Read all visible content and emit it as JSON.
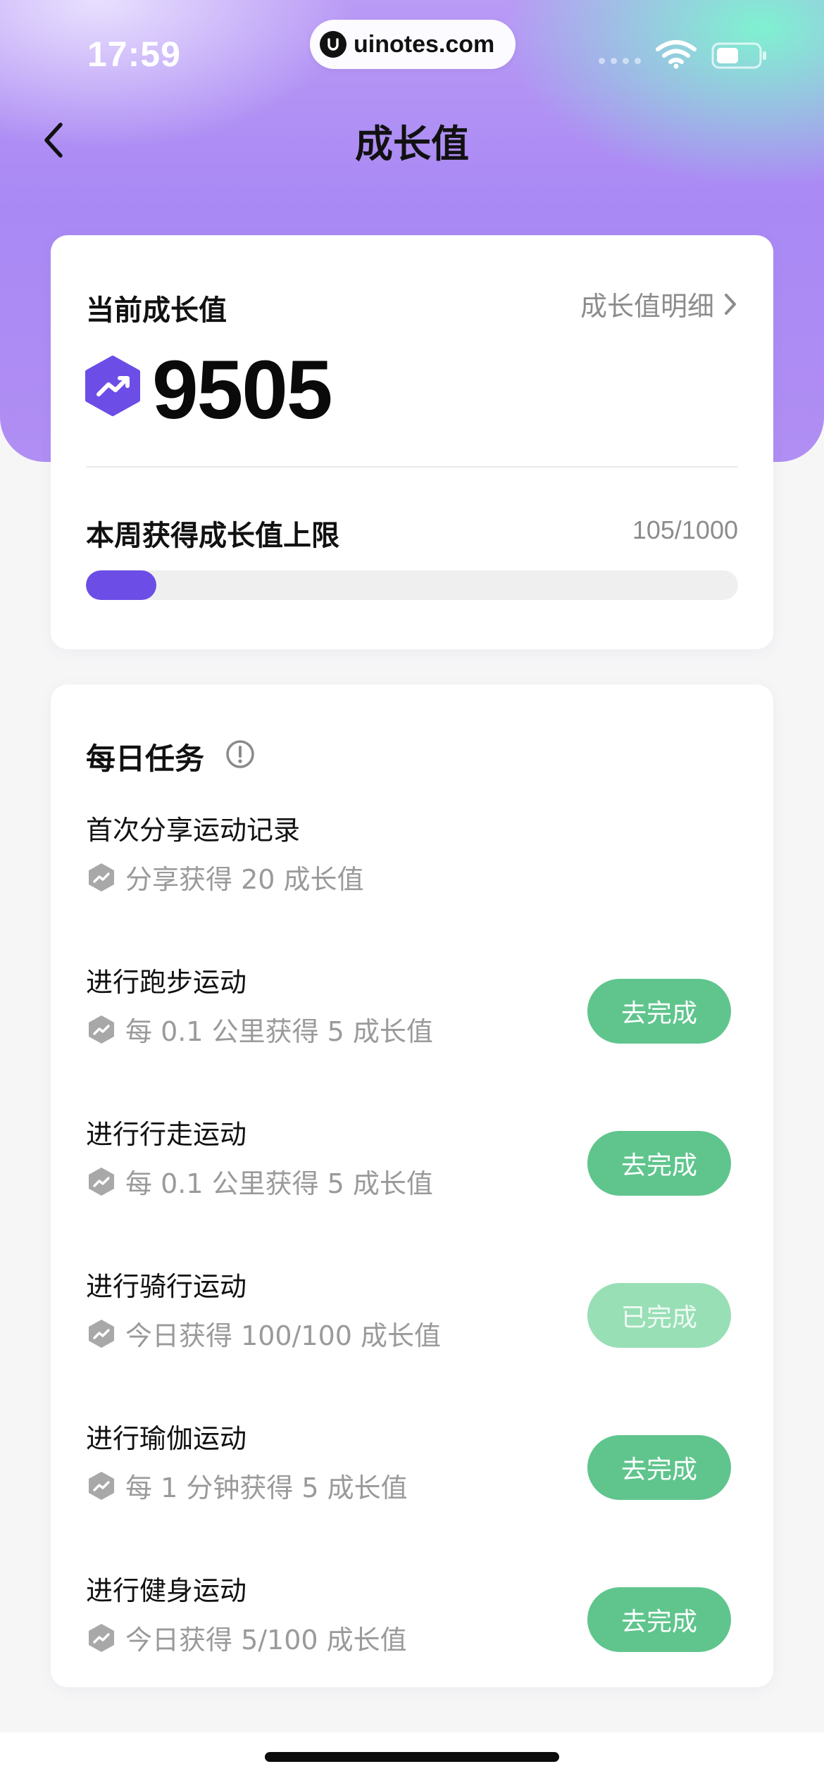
{
  "status_bar": {
    "time": "17:59",
    "url": "uinotes.com"
  },
  "nav": {
    "title": "成长值"
  },
  "summary": {
    "current_label": "当前成长值",
    "detail_link": "成长值明细",
    "value": "9505",
    "weekly_limit_label": "本周获得成长值上限",
    "weekly_count": "105/1000",
    "weekly_progress_fraction": 0.105
  },
  "tasks": {
    "title": "每日任务",
    "items": [
      {
        "name": "首次分享运动记录",
        "reward": "分享获得 20 成长值",
        "button": ""
      },
      {
        "name": "进行跑步运动",
        "reward": "每 0.1 公里获得 5 成长值",
        "button": "去完成"
      },
      {
        "name": "进行行走运动",
        "reward": "每 0.1 公里获得 5 成长值",
        "button": "去完成"
      },
      {
        "name": "进行骑行运动",
        "reward": "今日获得 100/100 成长值",
        "button": "已完成"
      },
      {
        "name": "进行瑜伽运动",
        "reward": "每 1 分钟获得 5 成长值",
        "button": "去完成"
      },
      {
        "name": "进行健身运动",
        "reward": "今日获得 5/100 成长值",
        "button": "去完成"
      }
    ]
  },
  "colors": {
    "accent_purple": "#6c4de6",
    "button_green": "#5fc58d",
    "button_done_green": "#98dfb6"
  }
}
